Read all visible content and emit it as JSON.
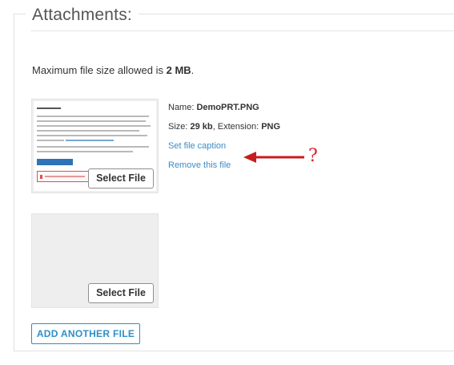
{
  "section": {
    "legend": "Attachments:"
  },
  "limits": {
    "prefix": "Maximum file size allowed is ",
    "size": "2 MB",
    "suffix": "."
  },
  "file1": {
    "name_label": "Name: ",
    "name_value": "DemoPRT.PNG",
    "size_label": "Size: ",
    "size_value": "29 kb",
    "ext_label": ", Extension: ",
    "ext_value": "PNG",
    "caption_link": "Set file caption",
    "remove_link": "Remove this file",
    "select_label": "Select File"
  },
  "file2": {
    "select_label": "Select File"
  },
  "add_button": "ADD ANOTHER FILE",
  "annotation": {
    "mark": "?",
    "color": "#d9202a"
  },
  "colors": {
    "link": "#3a8cc7",
    "accent": "#2d8fc9"
  }
}
